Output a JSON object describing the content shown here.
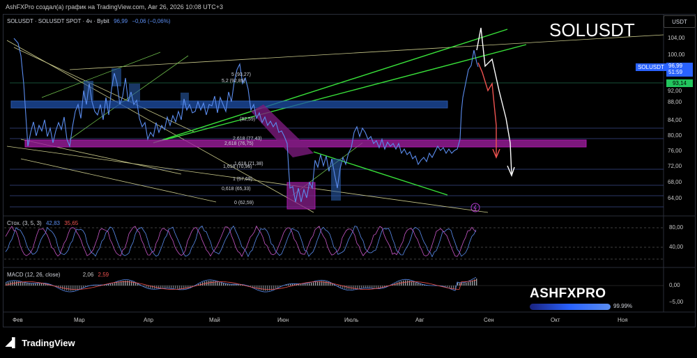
{
  "topbar": {
    "text": "AshFXPro создал(а) график на TradingView.com, Авг 26, 2026 10:08 UTC+3"
  },
  "header": {
    "symbol": "SOLUSDT · SOLUSDT SPOT · 4ч · Bybit",
    "price": "96,99",
    "change": "−0,06 (−0,06%)",
    "currency": "USDT",
    "title_overlay": "SOLUSDT"
  },
  "price_axis": {
    "ticks": [
      "104,00",
      "100,00",
      "92,00",
      "88,00",
      "84,00",
      "80,00",
      "76,00",
      "72,00",
      "68,00",
      "64,00"
    ],
    "symbol_label": "SOLUSDT",
    "last_price": "96,99",
    "countdown": "51:59",
    "green_level": "93,14"
  },
  "fib_labels": [
    "5 (93,27)",
    "5,2 (92,89)",
    "(82,59)",
    "2,618 (77,43)",
    "2,618 (76,75)",
    "1,618 (71,38)",
    "1,618 (70,96)",
    "1 (67,69)",
    "0,618 (65,33)",
    "0 (62,59)"
  ],
  "stoch": {
    "label": "Стох. (3, 5, 3)",
    "k": "42,83",
    "d": "35,65",
    "ticks": [
      "80,00",
      "40,00"
    ]
  },
  "macd": {
    "label": "MACD (12, 26, close)",
    "macd": "2,06",
    "signal": "2,59",
    "ticks": [
      "0,00",
      "−5,00"
    ]
  },
  "months": [
    "Фев",
    "Мар",
    "Апр",
    "Май",
    "Июн",
    "Июль",
    "Авг",
    "Сен",
    "Окт",
    "Ноя"
  ],
  "watermark": {
    "name": "ASHFXPRO",
    "percent": "99.99%"
  },
  "footer": {
    "brand": "TradingView"
  },
  "colors": {
    "up": "#5b8def",
    "accent_blue": "#2962ff",
    "green": "#22c55e",
    "magenta": "#d61cd8",
    "red": "#ef5350"
  }
}
